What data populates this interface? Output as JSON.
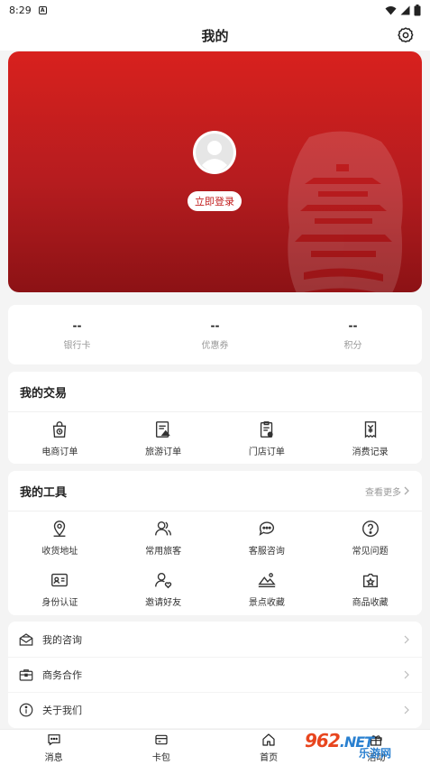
{
  "status_bar": {
    "time": "8:29",
    "badge": "A"
  },
  "header": {
    "title": "我的",
    "settings_icon": "gear-icon"
  },
  "profile": {
    "login_label": "立即登录",
    "avatar_icon": "user-avatar-icon"
  },
  "stats": [
    {
      "value": "--",
      "label": "银行卡"
    },
    {
      "value": "--",
      "label": "优惠券"
    },
    {
      "value": "--",
      "label": "积分"
    }
  ],
  "transactions": {
    "title": "我的交易",
    "items": [
      {
        "label": "电商订单",
        "icon": "shopping-bag-icon"
      },
      {
        "label": "旅游订单",
        "icon": "travel-order-icon"
      },
      {
        "label": "门店订单",
        "icon": "store-order-icon"
      },
      {
        "label": "消费记录",
        "icon": "receipt-yen-icon"
      }
    ]
  },
  "tools": {
    "title": "我的工具",
    "more_label": "查看更多",
    "items": [
      {
        "label": "收货地址",
        "icon": "location-pin-icon"
      },
      {
        "label": "常用旅客",
        "icon": "travelers-icon"
      },
      {
        "label": "客服咨询",
        "icon": "chat-bubble-icon"
      },
      {
        "label": "常见问题",
        "icon": "question-icon"
      },
      {
        "label": "身份认证",
        "icon": "id-card-icon"
      },
      {
        "label": "邀请好友",
        "icon": "invite-friend-icon"
      },
      {
        "label": "景点收藏",
        "icon": "scenic-spot-icon"
      },
      {
        "label": "商品收藏",
        "icon": "product-favorite-icon"
      }
    ]
  },
  "menu": [
    {
      "label": "我的咨询",
      "icon": "consult-mail-icon"
    },
    {
      "label": "商务合作",
      "icon": "briefcase-icon"
    },
    {
      "label": "关于我们",
      "icon": "info-icon"
    }
  ],
  "tabbar": [
    {
      "label": "消息",
      "icon": "message-icon"
    },
    {
      "label": "卡包",
      "icon": "wallet-icon"
    },
    {
      "label": "首页",
      "icon": "home-icon"
    },
    {
      "label": "活动",
      "icon": "gift-icon"
    }
  ],
  "watermark": {
    "top": "962",
    "net": ".NET",
    "bottom": "乐游网"
  },
  "colors": {
    "brand_red": "#c81e1e",
    "watermark_orange": "#e8451e",
    "watermark_blue": "#2a80d0"
  }
}
